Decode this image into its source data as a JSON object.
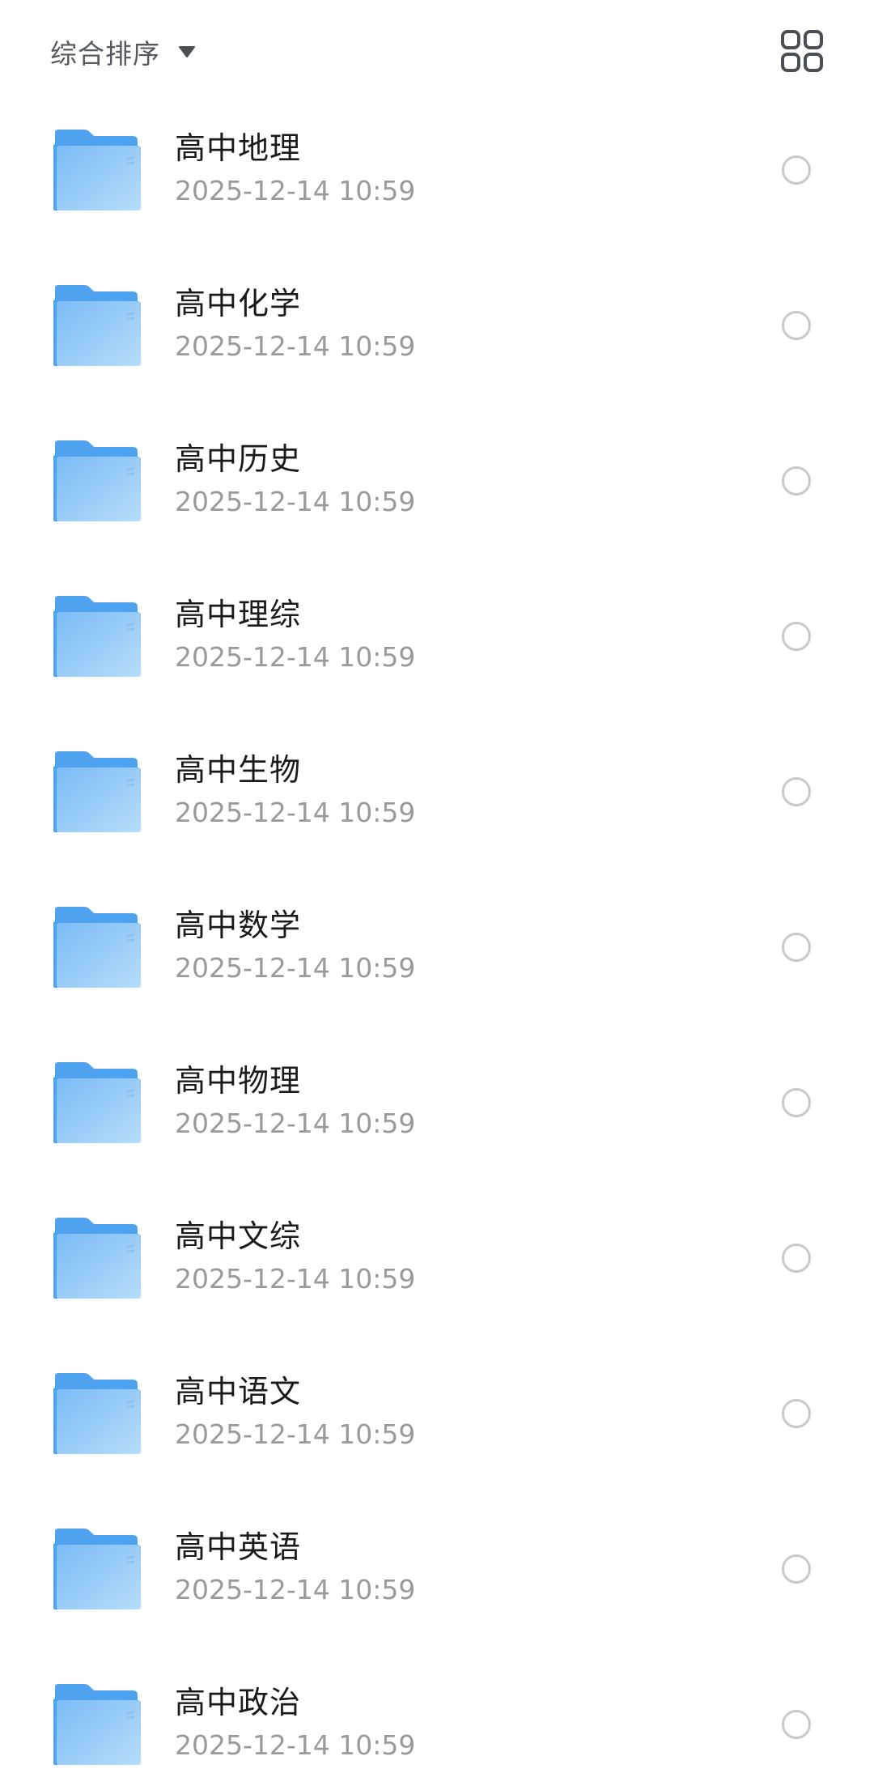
{
  "toolbar": {
    "sort_label": "综合排序",
    "sort_caret_icon": "caret-down-icon",
    "view_toggle_icon": "grid-view-icon"
  },
  "colors": {
    "folder_back": "#4fa3ee",
    "folder_front_light": "#b7dcfb",
    "folder_front_dark": "#7bbcf4",
    "title_text": "#1a1a1a",
    "date_text": "#9a9a9a",
    "radio_border": "#c9c9c9"
  },
  "folders": [
    {
      "name": "高中地理",
      "date": "2025-12-14 10:59"
    },
    {
      "name": "高中化学",
      "date": "2025-12-14 10:59"
    },
    {
      "name": "高中历史",
      "date": "2025-12-14 10:59"
    },
    {
      "name": "高中理综",
      "date": "2025-12-14 10:59"
    },
    {
      "name": "高中生物",
      "date": "2025-12-14 10:59"
    },
    {
      "name": "高中数学",
      "date": "2025-12-14 10:59"
    },
    {
      "name": "高中物理",
      "date": "2025-12-14 10:59"
    },
    {
      "name": "高中文综",
      "date": "2025-12-14 10:59"
    },
    {
      "name": "高中语文",
      "date": "2025-12-14 10:59"
    },
    {
      "name": "高中英语",
      "date": "2025-12-14 10:59"
    },
    {
      "name": "高中政治",
      "date": "2025-12-14 10:59"
    }
  ]
}
